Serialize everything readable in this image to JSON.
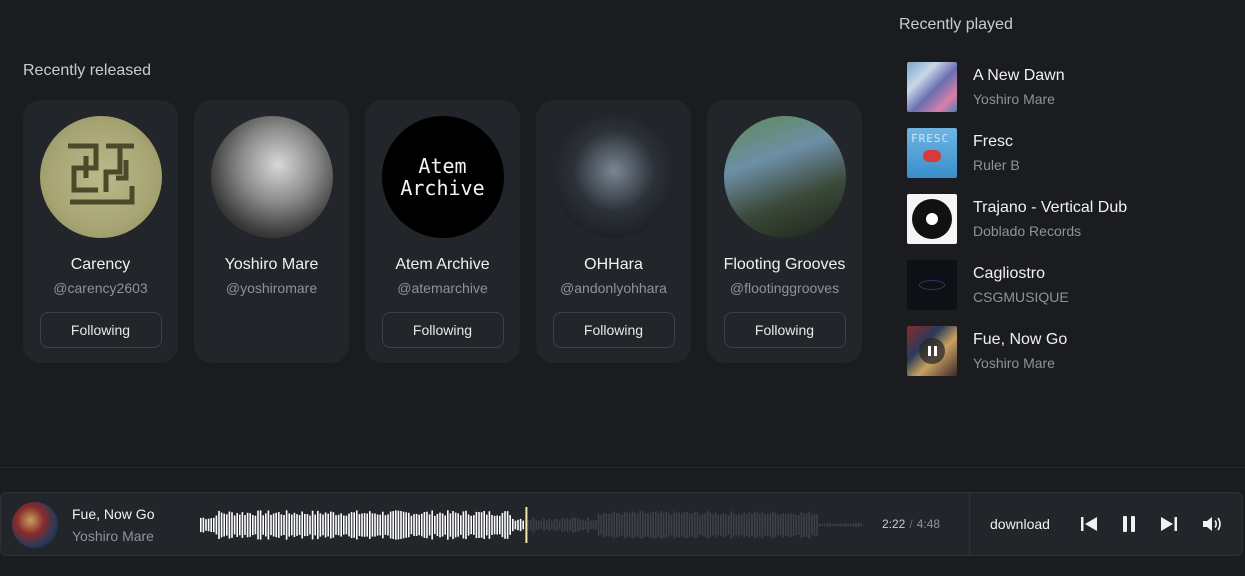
{
  "recently_released": {
    "title": "Recently released",
    "artists": [
      {
        "name": "Carency",
        "handle": "@carency2603",
        "button": "Following"
      },
      {
        "name": "Yoshiro Mare",
        "handle": "@yoshiromare",
        "button": ""
      },
      {
        "name": "Atem Archive",
        "handle": "@atemarchive",
        "button": "Following",
        "logo_lines": [
          "Atem",
          "Archive"
        ]
      },
      {
        "name": "OHHara",
        "handle": "@andonlyohhara",
        "button": "Following"
      },
      {
        "name": "Flooting Grooves",
        "handle": "@flootinggrooves",
        "button": "Following"
      }
    ]
  },
  "recently_played": {
    "title": "Recently played",
    "tracks": [
      {
        "title": "A New Dawn",
        "artist": "Yoshiro Mare"
      },
      {
        "title": "Fresc",
        "artist": "Ruler B",
        "cover_text": "FRESC"
      },
      {
        "title": "Trajano - Vertical Dub",
        "artist": "Doblado Records"
      },
      {
        "title": "Cagliostro",
        "artist": "CSGMUSIQUE"
      },
      {
        "title": "Fue, Now Go",
        "artist": "Yoshiro Mare",
        "playing": true
      }
    ]
  },
  "player": {
    "title": "Fue, Now Go",
    "artist": "Yoshiro Mare",
    "current_time": "2:22",
    "time_separator": "/",
    "duration": "4:48",
    "progress": 0.49,
    "download_label": "download",
    "icons": [
      "skip-back-icon",
      "pause-icon",
      "skip-forward-icon",
      "volume-icon"
    ]
  },
  "colors": {
    "background": "#1a1c20",
    "card": "#222529",
    "waveform_played": "#ffffff",
    "waveform_unplayed": "#3e4248",
    "playhead": "#f5e6a8"
  }
}
